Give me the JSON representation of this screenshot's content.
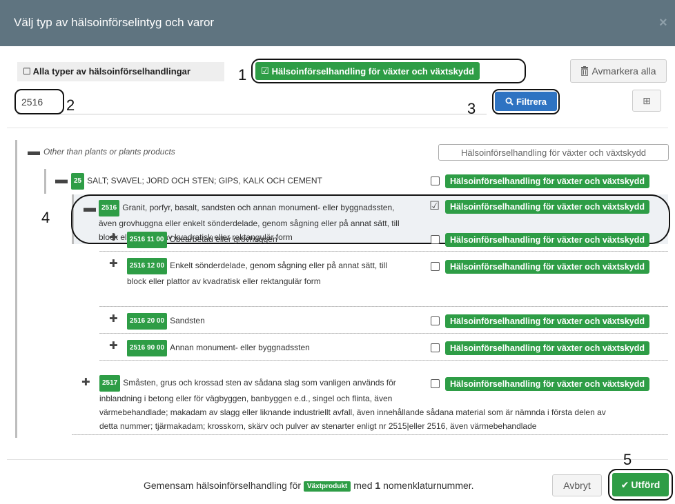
{
  "dialog": {
    "title": "Välj typ av hälsoinförselintyg och varor",
    "close_glyph": "×"
  },
  "toolbar": {
    "all_types_checkbox": "☐",
    "all_types_label": "Alla typer av hälsoinförselhandlingar",
    "plants_check_glyph": "☑",
    "plants_button_label": "Hälsoinförselhandling för växter och växtskydd",
    "unselect_all_label": "Avmarkera alla"
  },
  "filter": {
    "value": "2516",
    "button_label": "Filtrera",
    "expand_glyph": "⊞"
  },
  "annotations": {
    "n1": "1",
    "n2": "2",
    "n3": "3",
    "n4": "4",
    "n5": "5"
  },
  "tree": {
    "root": {
      "label": "Other than plants or plants products",
      "badge_label": "Hälsoinförselhandling för växter och växtskydd"
    },
    "chapter": {
      "code": "25",
      "label": "SALT; SVAVEL; JORD OCH STEN; GIPS, KALK OCH CEMENT",
      "badge_label": "Hälsoinförselhandling för växter och växtskydd"
    },
    "heading": {
      "code": "2516",
      "line1": "Granit, porfyr, basalt, sandsten och annan monument- eller byggnadssten,",
      "line2": "även grovhuggna eller enkelt sönderdelade, genom sågning eller på annat sätt, till",
      "line3": "block eller plattor av kvadratisk eller rektangulär form",
      "badge_label": "Hälsoinförselhandling för växter och växtskydd",
      "check_glyph": "☑"
    },
    "subs": [
      {
        "code": "2516 11 00",
        "line1": "Obearbetad eller grovhuggen",
        "badge_label": "Hälsoinförselhandling för växter och växtskydd"
      },
      {
        "code": "2516 12 00",
        "line1": "Enkelt sönderdelade, genom sågning eller på annat sätt, till",
        "line2": "block eller plattor av kvadratisk eller rektangulär form",
        "badge_label": "Hälsoinförselhandling för växter och växtskydd"
      },
      {
        "code": "2516 20 00",
        "line1": "Sandsten",
        "badge_label": "Hälsoinförselhandling för växter och växtskydd"
      },
      {
        "code": "2516 90 00",
        "line1": "Annan monument- eller byggnadssten",
        "badge_label": "Hälsoinförselhandling för växter och växtskydd"
      }
    ],
    "next": {
      "code": "2517",
      "line1": "Småsten, grus och krossad sten av sådana slag som vanligen används för",
      "line2": "inblandning i betong eller för vägbyggen, banbyggen e.d., singel och flinta, även",
      "line3": "värmebehandlade; makadam av slagg eller liknande industriellt avfall, även innehållande sådana material som är nämnda i första delen av",
      "line4": "detta nummer; tjärmakadam; krosskorn, skärv och pulver av stenarter enligt nr 2515|eller 2516, även värmebehandlade",
      "badge_label": "Hälsoinförselhandling för växter och växtskydd"
    },
    "collapse_glyph": "▬",
    "expand_glyph": "✚"
  },
  "footer": {
    "text_before": "Gemensam hälsoinförselhandling för",
    "product_badge": "Växtprodukt",
    "text_mid": "med",
    "count": "1",
    "text_after": "nomenklaturnummer.",
    "cancel_label": "Avbryt",
    "done_glyph": "✔",
    "done_label": "Utförd"
  },
  "colors": {
    "header": "#5f7480",
    "green": "#2e9d46",
    "blue": "#2e73c2"
  }
}
